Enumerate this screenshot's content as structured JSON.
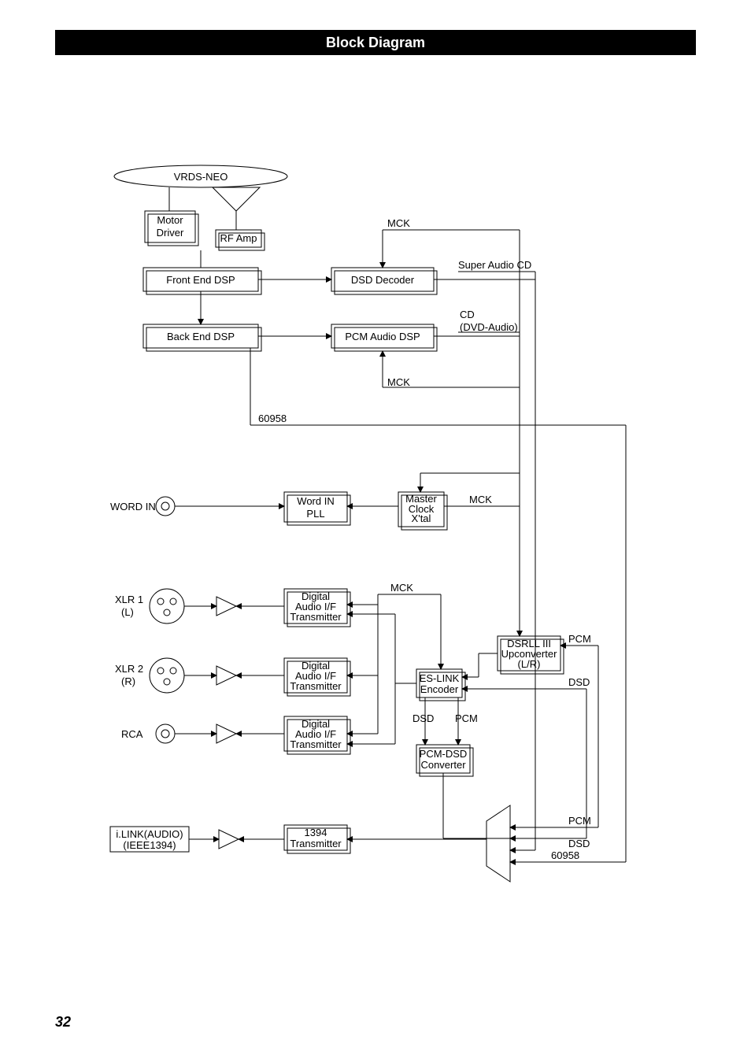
{
  "header": "Block Diagram",
  "pagenum": "32",
  "top_ellipse": "VRDS-NEO",
  "blocks": {
    "motor_driver": [
      "Motor",
      "Driver"
    ],
    "rf_amp": "RF Amp",
    "front_end_dsp": "Front End DSP",
    "dsd_decoder": "DSD Decoder",
    "back_end_dsp": "Back End DSP",
    "pcm_audio_dsp": "PCM Audio DSP",
    "word_in_pll": [
      "Word IN",
      "PLL"
    ],
    "master_clock_xtal": [
      "Master",
      "Clock",
      "X'tal"
    ],
    "d_a_if_t1": [
      "Digital",
      "Audio I/F",
      "Transmitter"
    ],
    "d_a_if_t2": [
      "Digital",
      "Audio I/F",
      "Transmitter"
    ],
    "d_a_if_t3": [
      "Digital",
      "Audio I/F",
      "Transmitter"
    ],
    "es_link_encoder": [
      "ES-LINK",
      "Encoder"
    ],
    "dsrll_up": [
      "DSRLL III",
      "Upconverter",
      "(L/R)"
    ],
    "pcm_dsd_conv": [
      "PCM-DSD",
      "Converter"
    ],
    "xfr_1394": [
      "1394",
      "Transmitter"
    ],
    "ilink": [
      "i.LINK(AUDIO)",
      "(IEEE1394)"
    ]
  },
  "labels": {
    "mck1": "MCK",
    "mck2": "MCK",
    "mck3": "MCK",
    "mck4": "MCK",
    "super_audio_cd": "Super Audio CD",
    "cd_dvd": [
      "CD",
      "(DVD-Audio)"
    ],
    "num60958a": "60958",
    "num60958b": "60958",
    "word_in_port": "WORD IN",
    "xlr1": [
      "XLR 1",
      "(L)"
    ],
    "xlr2": [
      "XLR 2",
      "(R)"
    ],
    "rca": "RCA",
    "dsd_left": "DSD",
    "pcm_right": "PCM",
    "pcm_up": "PCM",
    "dsd_up": "DSD",
    "mux_pcm": "PCM",
    "mux_dsd": "DSD"
  }
}
